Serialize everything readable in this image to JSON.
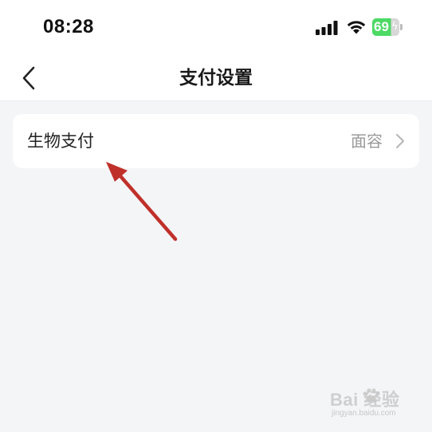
{
  "status_bar": {
    "time": "08:28",
    "battery_text": "69",
    "battery_level": 0.69,
    "icons": [
      "signal-icon",
      "wifi-icon",
      "battery-icon",
      "charging-bolt-icon"
    ]
  },
  "nav": {
    "back_icon": "chevron-left-icon",
    "title": "支付设置"
  },
  "settings": {
    "rows": [
      {
        "label": "生物支付",
        "value": "面容",
        "icon": "chevron-right-icon"
      }
    ]
  },
  "annotation": {
    "arrow_color": "#c0302a"
  },
  "watermark": {
    "logo": "Bai  经验",
    "sub": "jingyan.baidu.com"
  },
  "colors": {
    "background": "#f4f5f7",
    "card": "#ffffff",
    "battery_green": "#4cd964",
    "secondary_text": "#9a9a9a"
  }
}
